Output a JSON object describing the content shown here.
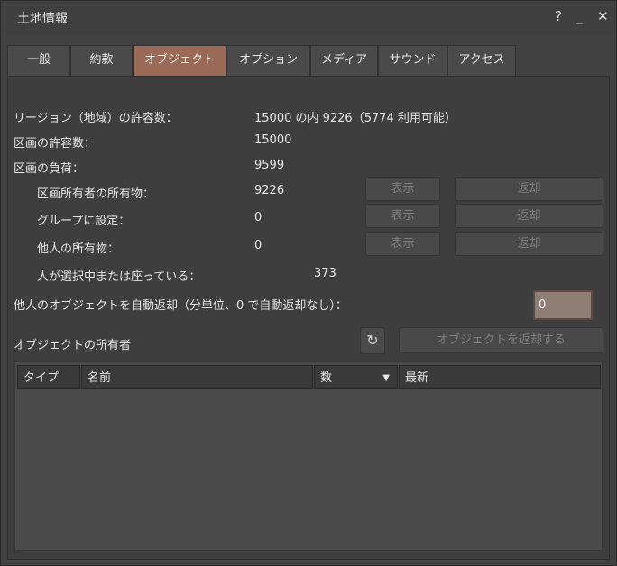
{
  "window": {
    "title": "土地情報",
    "help_glyph": "?",
    "minimize_glyph": "_",
    "close_glyph": "✕"
  },
  "tabs": [
    {
      "label": "一般"
    },
    {
      "label": "約款"
    },
    {
      "label": "オブジェクト",
      "active": true
    },
    {
      "label": "オプション"
    },
    {
      "label": "メディア"
    },
    {
      "label": "サウンド"
    },
    {
      "label": "アクセス"
    }
  ],
  "objects": {
    "region_capacity_label": "リージョン（地域）の許容数：",
    "region_capacity_value": "15000 の内 9226（5774 利用可能）",
    "parcel_capacity_label": "区画の許容数：",
    "parcel_capacity_value": "15000",
    "parcel_load_label": "区画の負荷：",
    "parcel_load_value": "9599",
    "owner_objects_label": "区画所有者の所有物：",
    "owner_objects_value": "9226",
    "group_objects_label": "グループに設定：",
    "group_objects_value": "0",
    "other_objects_label": "他人の所有物：",
    "other_objects_value": "0",
    "selected_sitting_label": "人が選択中または座っている：",
    "selected_sitting_value": "373",
    "show_label": "表示",
    "return_label": "返却",
    "autoreturn_label": "他人のオブジェクトを自動返却（分単位、0 で自動返却なし）：",
    "autoreturn_value": "0",
    "owners_label": "オブジェクトの所有者",
    "refresh_glyph": "↻",
    "return_objects_label": "オブジェクトを返却する"
  },
  "owners_table": {
    "columns": [
      "タイプ",
      "名前",
      "数",
      "最新"
    ],
    "sort_glyph": "▼",
    "rows": []
  }
}
